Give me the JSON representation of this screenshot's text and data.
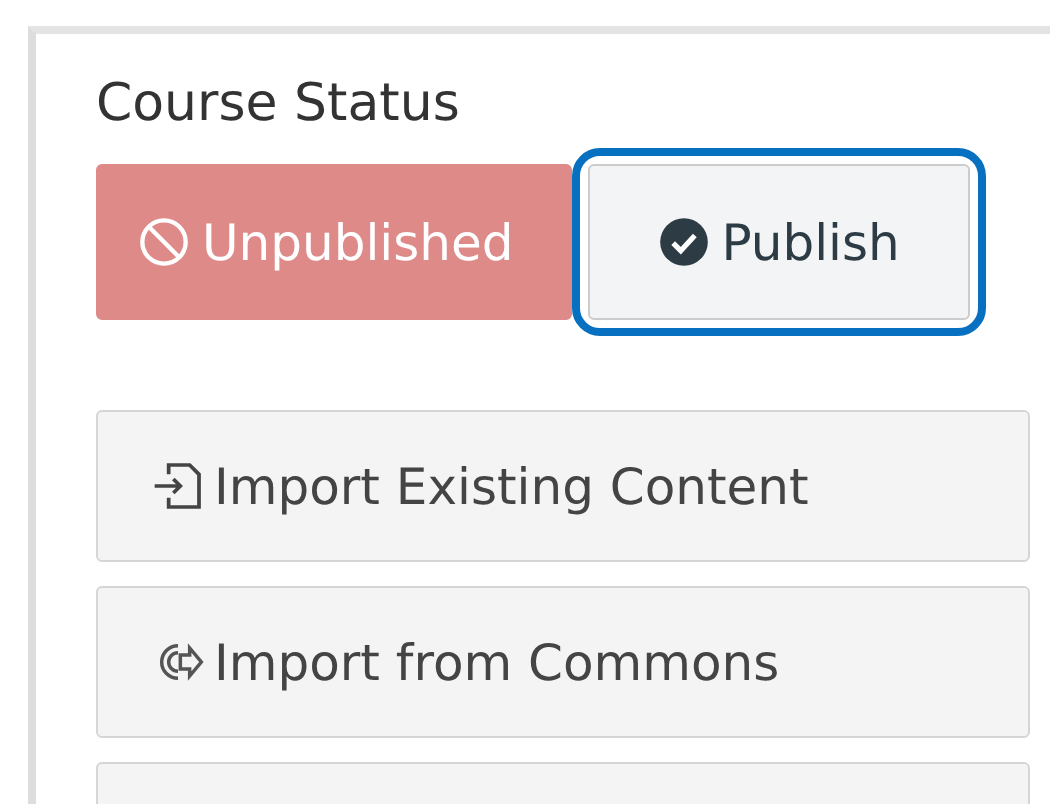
{
  "title": "Course Status",
  "status_buttons": [
    {
      "label": "Unpublished",
      "kind": "blocked",
      "selected": true,
      "focused": false
    },
    {
      "label": "Publish",
      "kind": "check",
      "selected": false,
      "focused": true
    }
  ],
  "actions": [
    {
      "label": "Import Existing Content",
      "kind": "import"
    },
    {
      "label": "Import from Commons",
      "kind": "commons"
    },
    {
      "kind": "blank"
    }
  ]
}
